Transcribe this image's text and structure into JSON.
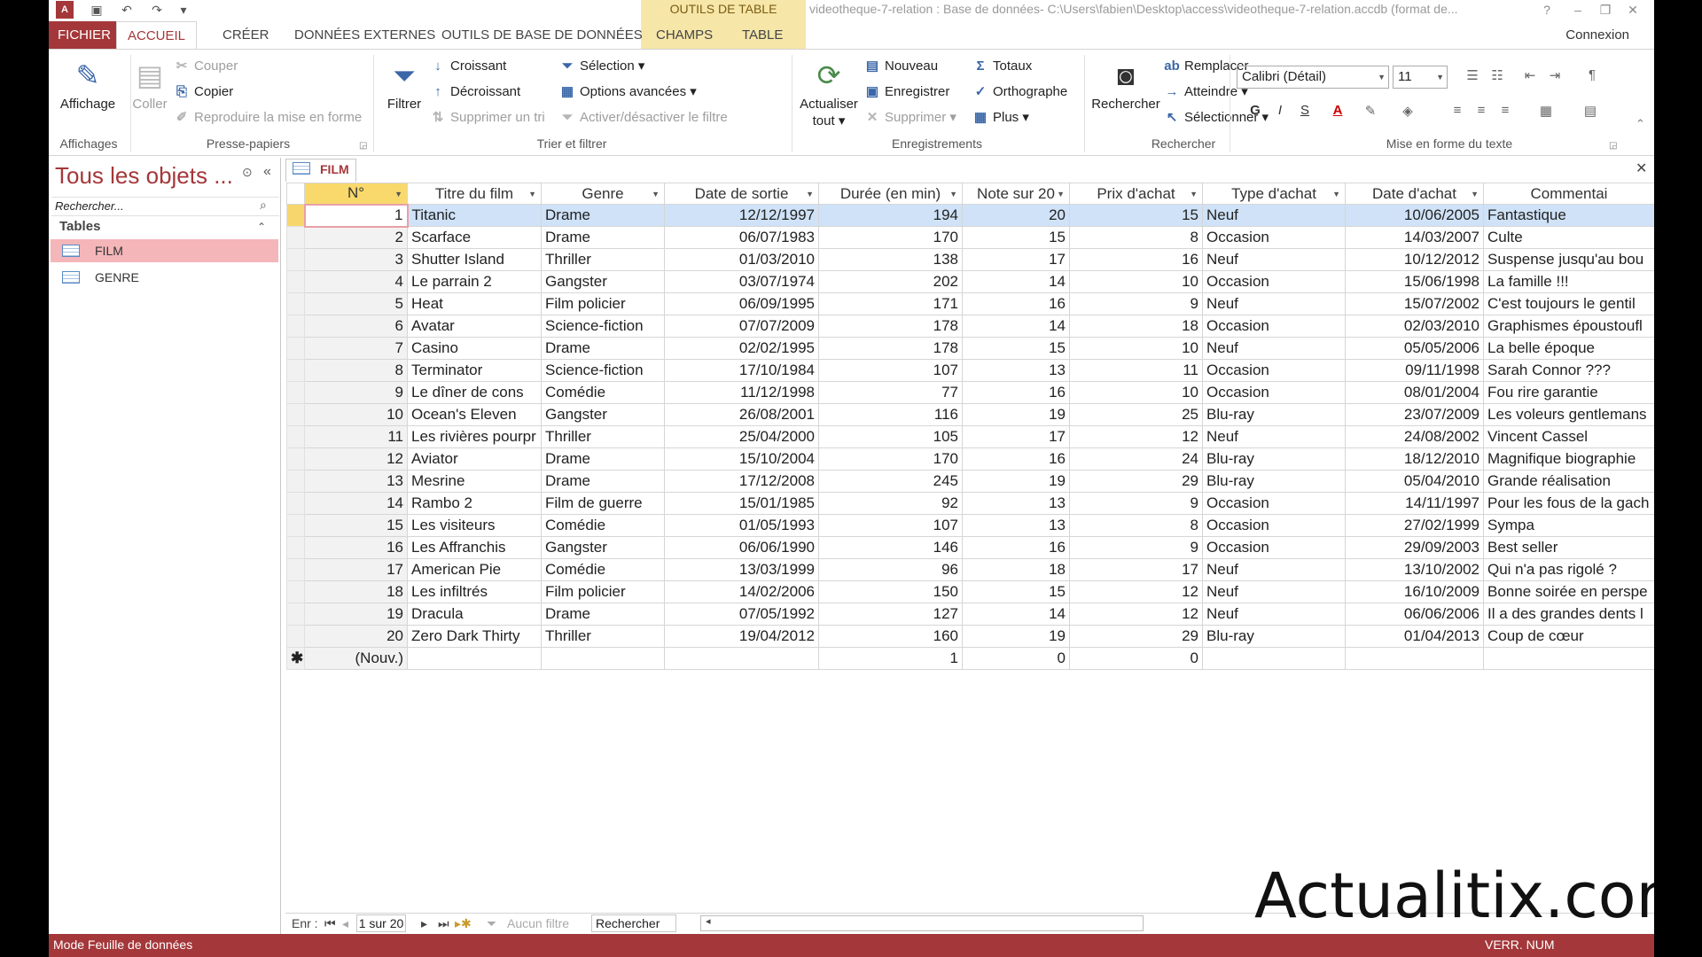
{
  "titlebar": {
    "app_icon": "A",
    "context_tools": "OUTILS DE TABLE",
    "title": "videotheque-7-relation : Base de données- C:\\Users\\fabien\\Desktop\\access\\videotheque-7-relation.accdb (format de...",
    "help": "?",
    "minimize": "–",
    "restore": "❐",
    "close": "✕"
  },
  "tabs": {
    "file": "FICHIER",
    "home": "ACCUEIL",
    "create": "CRÉER",
    "external": "DONNÉES EXTERNES",
    "dbtools": "OUTILS DE BASE DE DONNÉES",
    "fields": "CHAMPS",
    "table": "TABLE",
    "signin": "Connexion"
  },
  "ribbon": {
    "views": {
      "button": "Affichage",
      "group": "Affichages"
    },
    "clipboard": {
      "paste": "Coller",
      "cut": "Couper",
      "copy": "Copier",
      "format_painter": "Reproduire la mise en forme",
      "group": "Presse-papiers"
    },
    "sort_filter": {
      "filter": "Filtrer",
      "ascending": "Croissant",
      "descending": "Décroissant",
      "remove_sort": "Supprimer un tri",
      "selection": "Sélection",
      "advanced": "Options avancées",
      "toggle_filter": "Activer/désactiver le filtre",
      "group": "Trier et filtrer"
    },
    "records": {
      "refresh": "Actualiser",
      "refresh2": "tout",
      "new": "Nouveau",
      "save": "Enregistrer",
      "delete": "Supprimer",
      "totals": "Totaux",
      "spelling": "Orthographe",
      "more": "Plus",
      "group": "Enregistrements"
    },
    "find": {
      "find": "Rechercher",
      "replace": "Remplacer",
      "goto": "Atteindre",
      "select": "Sélectionner",
      "group": "Rechercher"
    },
    "text_format": {
      "font": "Calibri (Détail)",
      "size": "11",
      "bold": "G",
      "italic": "I",
      "underline": "S",
      "font_color": "A",
      "group": "Mise en forme du texte"
    }
  },
  "nav": {
    "title": "Tous les objets ...",
    "search_placeholder": "Rechercher...",
    "section": "Tables",
    "items": [
      {
        "label": "FILM"
      },
      {
        "label": "GENRE"
      }
    ]
  },
  "document": {
    "tab": "FILM"
  },
  "grid": {
    "columns": [
      "N°",
      "Titre du film",
      "Genre",
      "Date de sortie",
      "Durée (en min)",
      "Note sur 20",
      "Prix d'achat",
      "Type d'achat",
      "Date d'achat",
      "Commentai"
    ],
    "rows": [
      [
        "1",
        "Titanic",
        "Drame",
        "12/12/1997",
        "194",
        "20",
        "15",
        "Neuf",
        "10/06/2005",
        "Fantastique"
      ],
      [
        "2",
        "Scarface",
        "Drame",
        "06/07/1983",
        "170",
        "15",
        "8",
        "Occasion",
        "14/03/2007",
        "Culte"
      ],
      [
        "3",
        "Shutter Island",
        "Thriller",
        "01/03/2010",
        "138",
        "17",
        "16",
        "Neuf",
        "10/12/2012",
        "Suspense jusqu'au bou"
      ],
      [
        "4",
        "Le parrain 2",
        "Gangster",
        "03/07/1974",
        "202",
        "14",
        "10",
        "Occasion",
        "15/06/1998",
        "La famille !!!"
      ],
      [
        "5",
        "Heat",
        "Film policier",
        "06/09/1995",
        "171",
        "16",
        "9",
        "Neuf",
        "15/07/2002",
        "C'est toujours le gentil"
      ],
      [
        "6",
        "Avatar",
        "Science-fiction",
        "07/07/2009",
        "178",
        "14",
        "18",
        "Occasion",
        "02/03/2010",
        "Graphismes époustoufl"
      ],
      [
        "7",
        "Casino",
        "Drame",
        "02/02/1995",
        "178",
        "15",
        "10",
        "Neuf",
        "05/05/2006",
        "La belle époque"
      ],
      [
        "8",
        "Terminator",
        "Science-fiction",
        "17/10/1984",
        "107",
        "13",
        "11",
        "Occasion",
        "09/11/1998",
        "Sarah Connor ???"
      ],
      [
        "9",
        "Le dîner de cons",
        "Comédie",
        "11/12/1998",
        "77",
        "16",
        "10",
        "Occasion",
        "08/01/2004",
        "Fou rire garantie"
      ],
      [
        "10",
        "Ocean's Eleven",
        "Gangster",
        "26/08/2001",
        "116",
        "19",
        "25",
        "Blu-ray",
        "23/07/2009",
        "Les voleurs gentlemans"
      ],
      [
        "11",
        "Les rivières pourpr",
        "Thriller",
        "25/04/2000",
        "105",
        "17",
        "12",
        "Neuf",
        "24/08/2002",
        "Vincent Cassel"
      ],
      [
        "12",
        "Aviator",
        "Drame",
        "15/10/2004",
        "170",
        "16",
        "24",
        "Blu-ray",
        "18/12/2010",
        "Magnifique biographie"
      ],
      [
        "13",
        "Mesrine",
        "Drame",
        "17/12/2008",
        "245",
        "19",
        "29",
        "Blu-ray",
        "05/04/2010",
        "Grande réalisation"
      ],
      [
        "14",
        "Rambo 2",
        "Film de guerre",
        "15/01/1985",
        "92",
        "13",
        "9",
        "Occasion",
        "14/11/1997",
        "Pour les fous de la gach"
      ],
      [
        "15",
        "Les visiteurs",
        "Comédie",
        "01/05/1993",
        "107",
        "13",
        "8",
        "Occasion",
        "27/02/1999",
        "Sympa"
      ],
      [
        "16",
        "Les Affranchis",
        "Gangster",
        "06/06/1990",
        "146",
        "16",
        "9",
        "Occasion",
        "29/09/2003",
        "Best seller"
      ],
      [
        "17",
        "American Pie",
        "Comédie",
        "13/03/1999",
        "96",
        "18",
        "17",
        "Neuf",
        "13/10/2002",
        "Qui n'a pas rigolé ?"
      ],
      [
        "18",
        "Les infiltrés",
        "Film policier",
        "14/02/2006",
        "150",
        "15",
        "12",
        "Neuf",
        "16/10/2009",
        "Bonne soirée en perspe"
      ],
      [
        "19",
        "Dracula",
        "Drame",
        "07/05/1992",
        "127",
        "14",
        "12",
        "Neuf",
        "06/06/2006",
        "Il a des grandes dents l"
      ],
      [
        "20",
        "Zero Dark Thirty",
        "Thriller",
        "19/04/2012",
        "160",
        "19",
        "29",
        "Blu-ray",
        "01/04/2013",
        "Coup de cœur"
      ]
    ],
    "new_row": {
      "marker": "✱",
      "id": "(Nouv.)",
      "duration": "1",
      "rating": "0",
      "price": "0"
    }
  },
  "recnav": {
    "label": "Enr :",
    "position": "1 sur 20",
    "filter": "Aucun filtre",
    "search": "Rechercher"
  },
  "status": {
    "left": "Mode Feuille de données",
    "right": "VERR. NUM"
  },
  "watermark": "Actualitix.com",
  "colors": {
    "accent": "#a4373a",
    "selection_header": "#f9d96c",
    "current_row": "#cfe2f7",
    "tools_band": "#f6e6a8"
  }
}
